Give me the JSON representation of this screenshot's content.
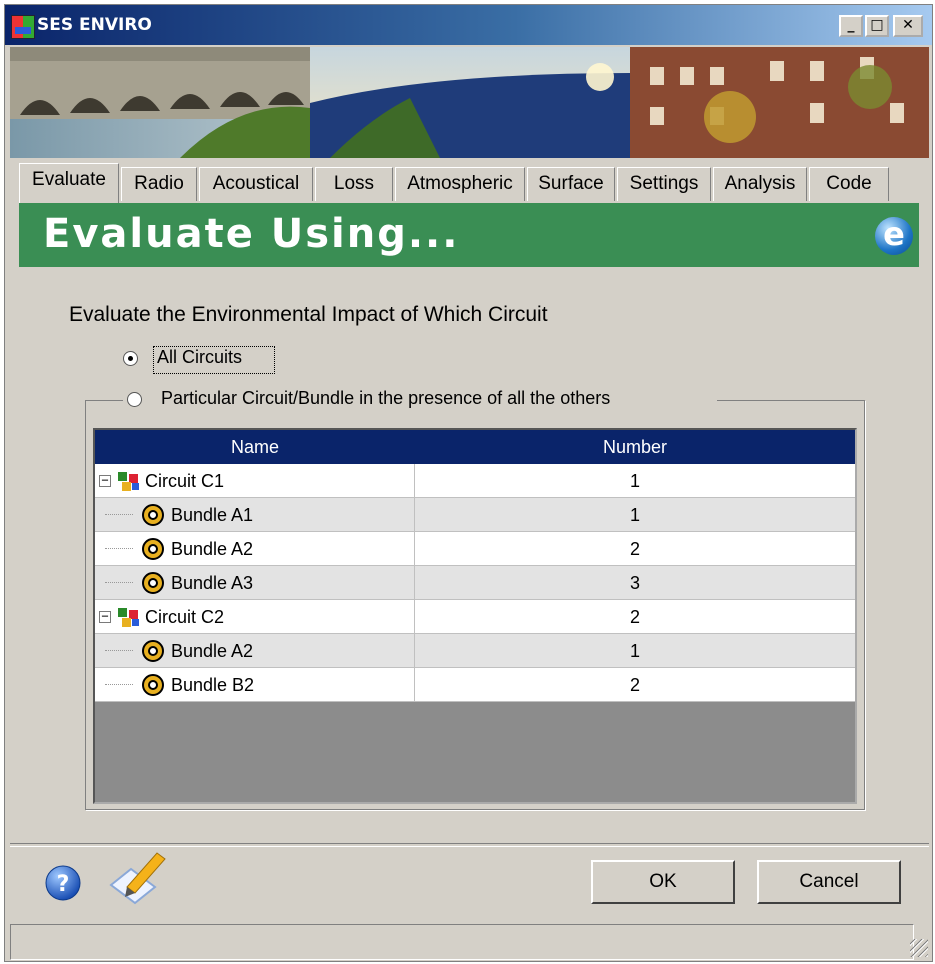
{
  "window": {
    "title": "SES ENVIRO",
    "min_symbol": "_",
    "max_symbol": "□",
    "close_symbol": "✕"
  },
  "tabs": [
    "Evaluate",
    "Radio",
    "Acoustical",
    "Loss",
    "Atmospheric",
    "Surface",
    "Settings",
    "Analysis",
    "Code"
  ],
  "header": {
    "title": "Evaluate Using..."
  },
  "main": {
    "question": "Evaluate the Environmental Impact of Which Circuit",
    "radio_all": "All Circuits",
    "radio_particular": "Particular Circuit/Bundle in the presence of all the others",
    "selected": "all"
  },
  "grid": {
    "columns": [
      "Name",
      "Number"
    ],
    "rows": [
      {
        "name": "Circuit C1",
        "number": "1",
        "kind": "circuit"
      },
      {
        "name": "Bundle A1",
        "number": "1",
        "kind": "bundle"
      },
      {
        "name": "Bundle A2",
        "number": "2",
        "kind": "bundle"
      },
      {
        "name": "Bundle A3",
        "number": "3",
        "kind": "bundle"
      },
      {
        "name": "Circuit C2",
        "number": "2",
        "kind": "circuit"
      },
      {
        "name": "Bundle A2",
        "number": "1",
        "kind": "bundle"
      },
      {
        "name": "Bundle B2",
        "number": "2",
        "kind": "bundle"
      }
    ]
  },
  "buttons": {
    "ok": "OK",
    "cancel": "Cancel"
  },
  "icons": [
    "app-icon",
    "help-icon",
    "edit-icon",
    "evaluate-e-icon",
    "circuit-icon",
    "bundle-icon"
  ]
}
